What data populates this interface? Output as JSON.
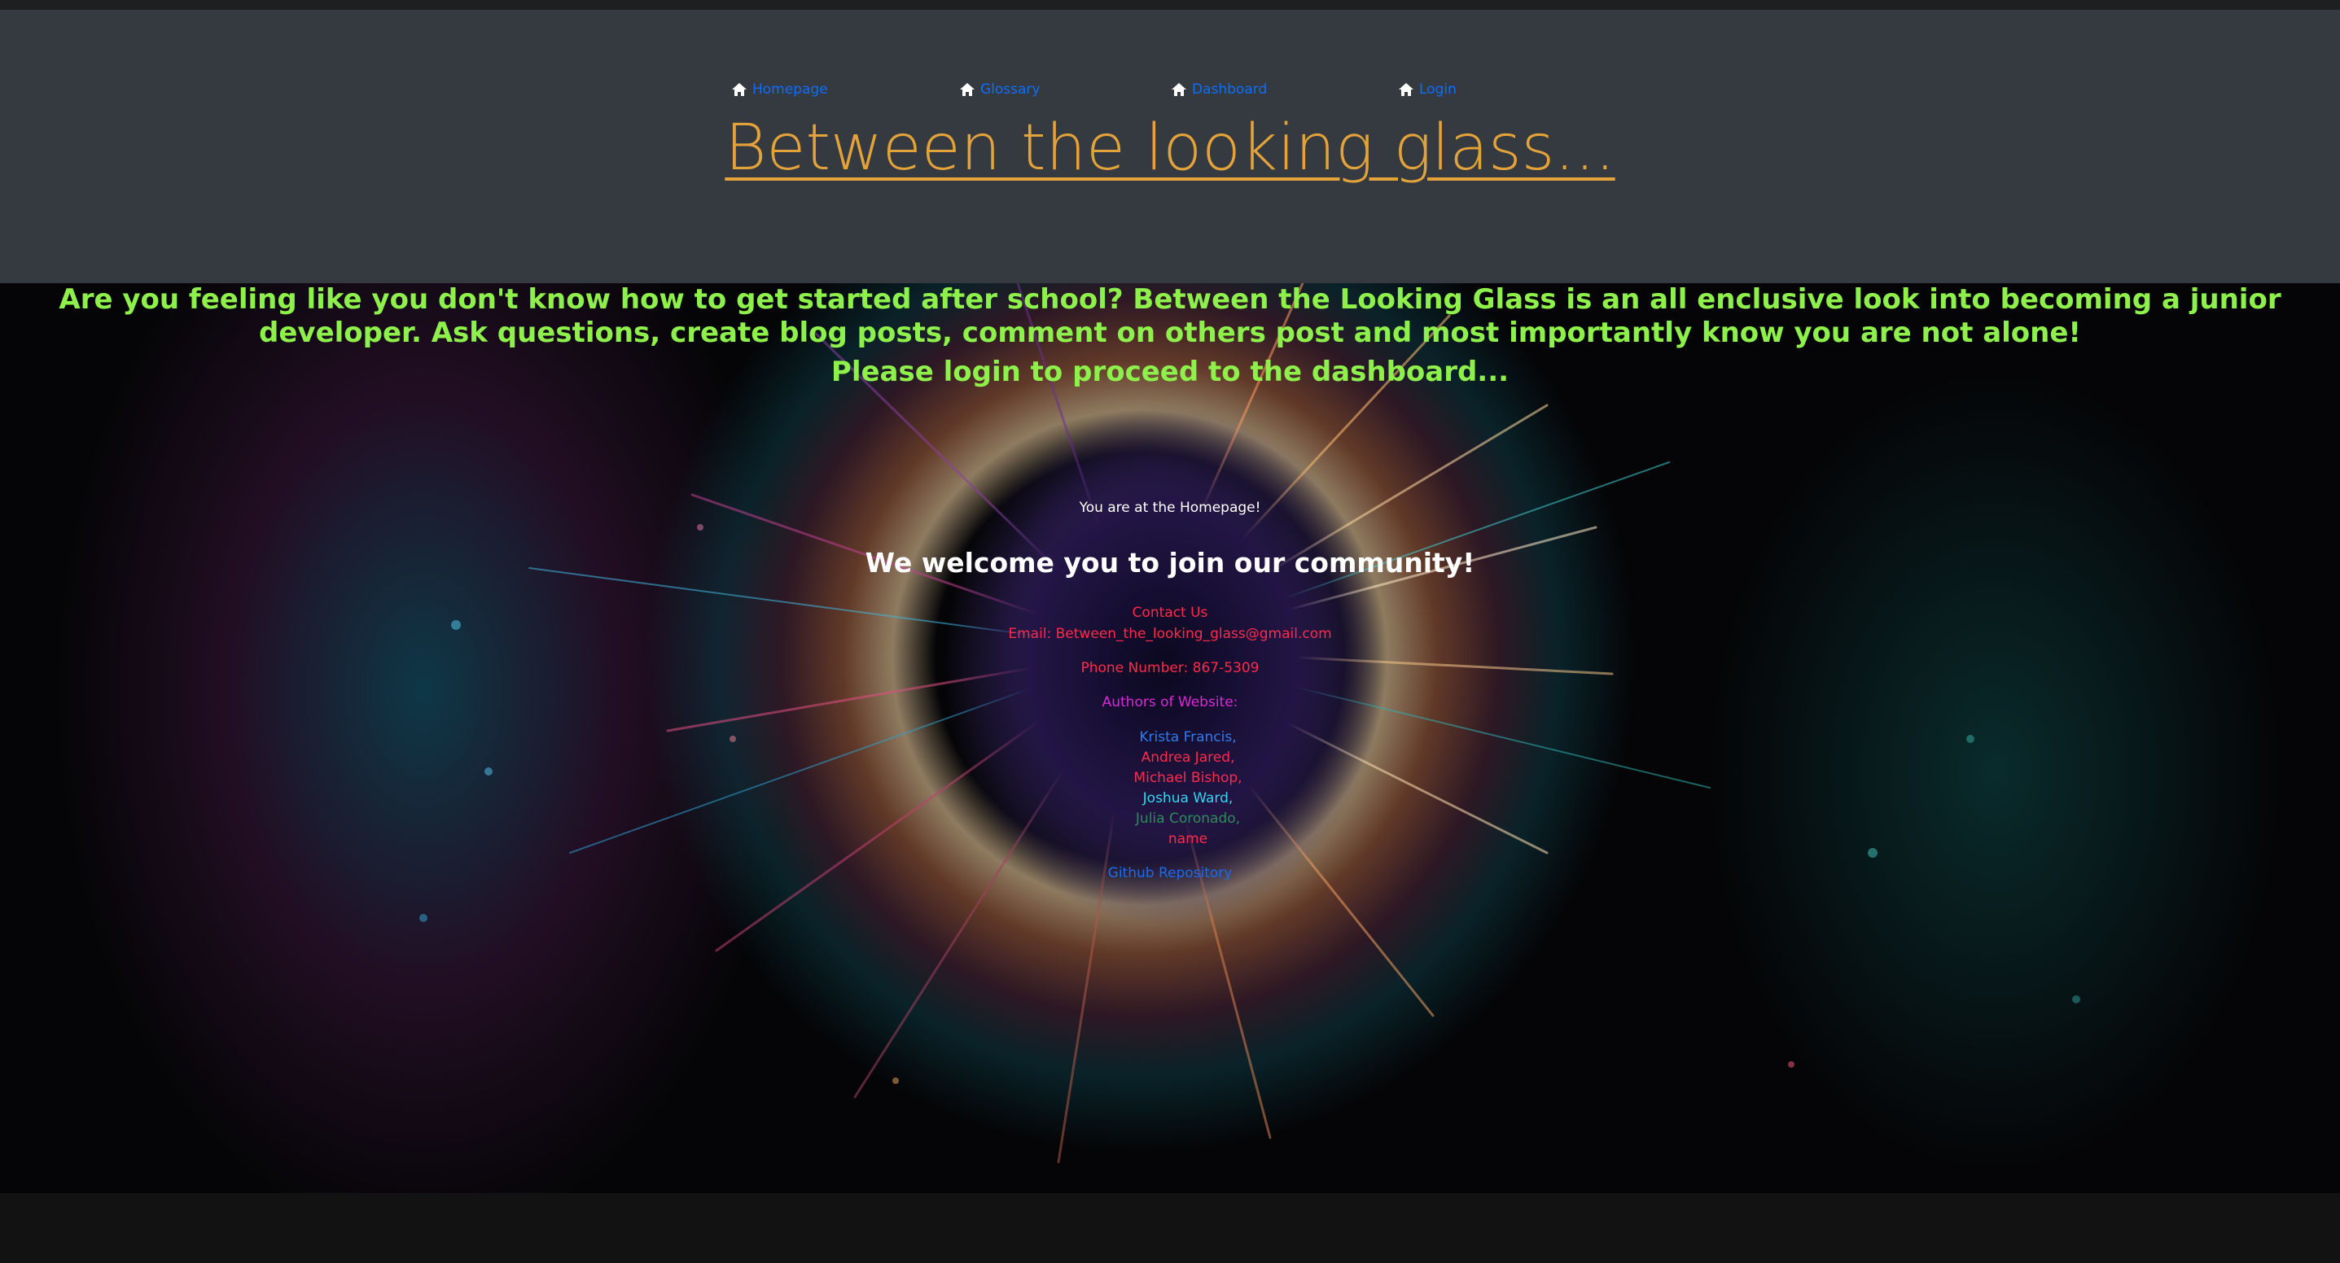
{
  "nav": {
    "items": [
      {
        "label": "Homepage",
        "icon": "home-icon"
      },
      {
        "label": "Glossary",
        "icon": "home-icon"
      },
      {
        "label": "Dashboard",
        "icon": "home-icon"
      },
      {
        "label": "Login",
        "icon": "home-icon"
      }
    ],
    "link_color": "#0d6efd"
  },
  "header": {
    "title": "Between the looking glass...",
    "title_color": "#e4a23a",
    "background": "#343a40"
  },
  "main": {
    "intro": "Are you feeling like you don't know how to get started after school? Between the Looking Glass is an all enclusive look into becoming a junior developer. Ask questions, create blog posts, comment on others post and most importantly know you are not alone!",
    "login_prompt": "Please login to proceed to the dashboard...",
    "location_message": "You are at the Homepage!",
    "welcome": "We welcome you to join our community!",
    "accent_green": "#8ef04a"
  },
  "contact": {
    "heading": "Contact Us",
    "email": "Email: Between_the_looking_glass@gmail.com",
    "phone": "Phone Number: 867-5309"
  },
  "authors": {
    "heading": "Authors of Website:",
    "names": [
      "Krista Francis,",
      "Andrea Jared,",
      "Michael Bishop,",
      "Joshua Ward,",
      "Julia Coronado,",
      "name"
    ]
  },
  "github_link": "Github Repository"
}
